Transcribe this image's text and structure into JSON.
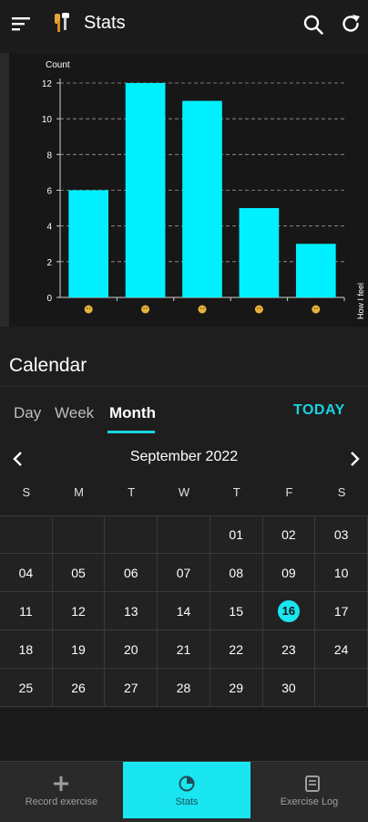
{
  "appbar": {
    "title": "Stats",
    "icons": [
      "menu-icon",
      "app-logo-icon",
      "search-icon",
      "refresh-icon"
    ]
  },
  "chart_data": {
    "type": "bar",
    "categories": [
      "emoji-1",
      "emoji-2",
      "emoji-3",
      "emoji-4",
      "emoji-5"
    ],
    "values": [
      6,
      12,
      11,
      5,
      3
    ],
    "ylabel": "Count",
    "xlabel": "How I feel",
    "ylim": [
      0,
      12
    ],
    "yticks": [
      0,
      2,
      4,
      6,
      8,
      10,
      12
    ],
    "bar_color": "#00f0ff",
    "grid": true
  },
  "calendar": {
    "title": "Calendar",
    "tabs": [
      {
        "label": "Day"
      },
      {
        "label": "Week"
      },
      {
        "label": "Month"
      }
    ],
    "active_tab": "Month",
    "today_label": "TODAY",
    "month_label": "September 2022",
    "weekdays": [
      "S",
      "M",
      "T",
      "W",
      "T",
      "F",
      "S"
    ],
    "weeks": [
      [
        "",
        "",
        "",
        "",
        "01",
        "02",
        "03"
      ],
      [
        "04",
        "05",
        "06",
        "07",
        "08",
        "09",
        "10"
      ],
      [
        "11",
        "12",
        "13",
        "14",
        "15",
        "16",
        "17"
      ],
      [
        "18",
        "19",
        "20",
        "21",
        "22",
        "23",
        "24"
      ],
      [
        "25",
        "26",
        "27",
        "28",
        "29",
        "30",
        ""
      ]
    ],
    "selected_day": "16",
    "accent": "#19e6f0"
  },
  "bottom_nav": {
    "items": [
      {
        "label": "Record exercise",
        "icon": "plus-icon"
      },
      {
        "label": "Stats",
        "icon": "pie-chart-icon"
      },
      {
        "label": "Exercise Log",
        "icon": "log-book-icon"
      }
    ],
    "active": "Stats"
  }
}
